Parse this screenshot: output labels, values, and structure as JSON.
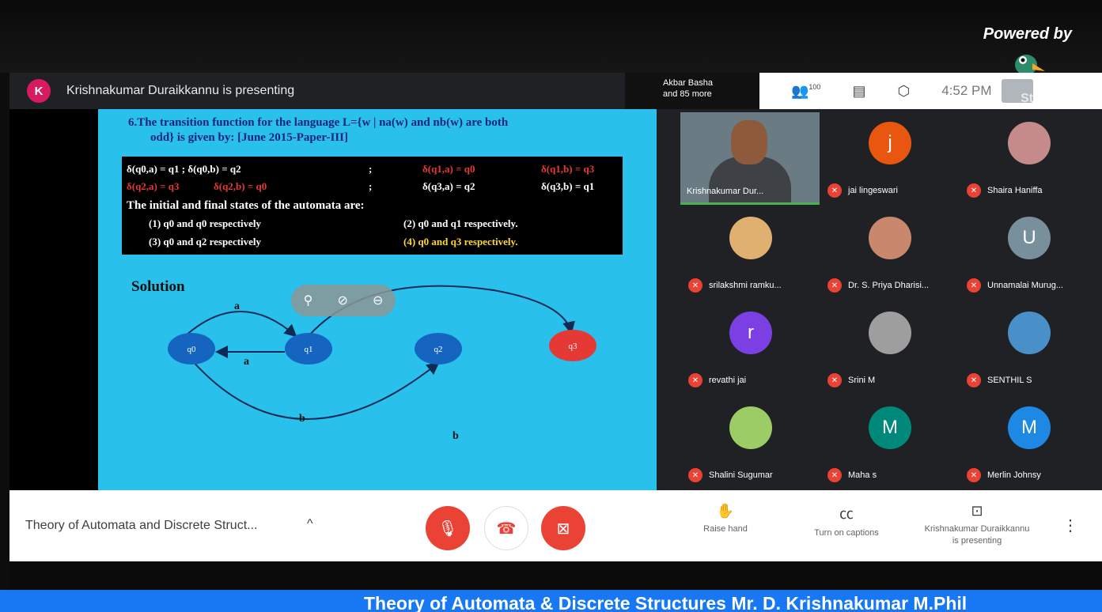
{
  "watermark": {
    "powered_by": "Powered by",
    "brand_icon": "duck-logo-icon"
  },
  "presenter_bar": {
    "initial": "K",
    "text": "Krishnakumar Duraikkannu is presenting"
  },
  "top_bar": {
    "others": "Akbar Basha",
    "others_line2": "and 85 more",
    "participants_count": "100",
    "time": "4:52 PM",
    "streamyard": "StreamYard"
  },
  "slide": {
    "title_line1": "6.The transition function for the language L={w | na(w) and nb(w) are both",
    "title_line2": "odd} is given by: [June 2015-Paper-III]",
    "eq_row1_left": "δ(q0,a) = q1   ; δ(q0,b) = q2",
    "eq_row1_sep": ";",
    "eq_row1_right_a": "δ(q1,a) = q0",
    "eq_row1_right_b": "δ(q1,b) = q3",
    "eq_row2_left_a": "δ(q2,a) = q3",
    "eq_row2_left_b": "δ(q2,b) = q0",
    "eq_row2_right_a": "δ(q3,a) = q2",
    "eq_row2_right_b": "δ(q3,b) = q1",
    "question": "The initial and final states of the automata are:",
    "opt1": "(1) q0 and q0 respectively",
    "opt2": "(2) q0 and q1 respectively.",
    "opt3": "(3) q0 and q2 respectively",
    "opt4": "(4) q0 and q3 respectively.",
    "solution": "Solution",
    "states": [
      "q0",
      "q1",
      "q2",
      "q3"
    ],
    "edge_labels": {
      "q0_q1": "a",
      "q1_q0": "a",
      "q0_q2": "b",
      "q1_q3_b": "b"
    }
  },
  "participants": {
    "self": "Krishnakumar Dur...",
    "tiles": [
      {
        "name": "jai lingeswari",
        "initial": "j",
        "color": "#e8560f"
      },
      {
        "name": "Shaira Haniffa",
        "initial": "",
        "color": "#c58a8a"
      },
      {
        "name": "srilakshmi ramku...",
        "initial": "",
        "color": "#e0b070"
      },
      {
        "name": "Dr. S. Priya Dharisi...",
        "initial": "",
        "color": "#c9876d"
      },
      {
        "name": "Unnamalai Murug...",
        "initial": "U",
        "color": "#78909c"
      },
      {
        "name": "revathi jai",
        "initial": "r",
        "color": "#7b3fe4"
      },
      {
        "name": "Srini M",
        "initial": "",
        "color": "#9e9e9e"
      },
      {
        "name": "SENTHIL S",
        "initial": "",
        "color": "#4a90c8"
      },
      {
        "name": "Shalini Sugumar",
        "initial": "",
        "color": "#9ccc65"
      },
      {
        "name": "Maha s",
        "initial": "M",
        "color": "#00897b"
      },
      {
        "name": "Merlin Johnsy",
        "initial": "M",
        "color": "#1e88e5"
      }
    ]
  },
  "bottom_bar": {
    "meeting_title": "Theory of Automata and Discrete Struct...",
    "raise_hand": "Raise hand",
    "captions": "Turn on captions",
    "presenting_line1": "Krishnakumar Duraikkannu",
    "presenting_line2": "is presenting"
  },
  "banner": {
    "text": "Theory of Automata & Discrete Structures  Mr. D. Krishnakumar M.Phil"
  }
}
